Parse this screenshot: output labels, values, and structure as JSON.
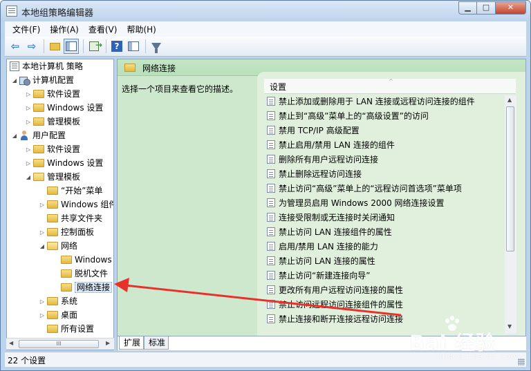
{
  "window": {
    "title": "本地组策略编辑器",
    "minimize_glyph": "▁",
    "maximize_glyph": "□",
    "close_glyph": "✕"
  },
  "menu": [
    "文件(F)",
    "操作(A)",
    "查看(V)",
    "帮助(H)"
  ],
  "toolbar": {
    "back_glyph": "⇦",
    "forward_glyph": "⇨",
    "help_glyph": "?"
  },
  "tree": {
    "root": "本地计算机 策略",
    "computer_config": "计算机配置",
    "software_settings_1": "软件设置",
    "windows_settings_1": "Windows 设置",
    "admin_templates_1": "管理模板",
    "user_config": "用户配置",
    "software_settings_2": "软件设置",
    "windows_settings_2": "Windows 设置",
    "admin_templates_2": "管理模板",
    "start_menu": "“开始”菜单",
    "windows_components": "Windows 组件",
    "shared_folders": "共享文件夹",
    "control_panel": "控制面板",
    "network": "网络",
    "windows_connect_now": "Windows",
    "offline_files": "脱机文件",
    "network_connections": "网络连接",
    "system": "系统",
    "desktop": "桌面",
    "all_settings": "所有设置",
    "expanded_glyph": "◢",
    "collapsed_glyph": "▷"
  },
  "scroll": {
    "thumb_glyph": "III",
    "left_glyph": "◀",
    "right_glyph": "▶",
    "up_glyph": "▲",
    "down_glyph": "▼",
    "sort_glyph": "^"
  },
  "right_pane": {
    "header_title": "网络连接",
    "description_prompt": "选择一个项目来查看它的描述。",
    "column_header": "设置",
    "items": [
      "禁止添加或删除用于 LAN 连接或远程访问连接的组件",
      "禁止到“高级”菜单上的“高级设置”的访问",
      "禁用 TCP/IP 高级配置",
      "禁止启用/禁用 LAN 连接的组件",
      "删除所有用户远程访问连接",
      "禁止删除远程访问连接",
      "禁止访问“高级”菜单上的“远程访问首选项”菜单项",
      "为管理员启用 Windows 2000 网络连接设置",
      "连接受限制或无连接时关闭通知",
      "禁止访问 LAN 连接组件的属性",
      "启用/禁用 LAN 连接的能力",
      "禁止访问 LAN 连接的属性",
      "禁止访问“新建连接向导”",
      "更改所有用户远程访问连接的属性",
      "禁止访问远程访问连接组件的属性",
      "禁止连接和断开连接远程访问连接"
    ]
  },
  "tabs": [
    "扩展",
    "标准"
  ],
  "status": {
    "text": "22 个设置"
  },
  "watermark": {
    "brand": "Bai 经验",
    "url": "jingyan.baidu.com"
  },
  "colors": {
    "annotation_arrow": "#e8302c",
    "pane_green": "#cde8cd",
    "window_frame": "#bcd3ec"
  }
}
